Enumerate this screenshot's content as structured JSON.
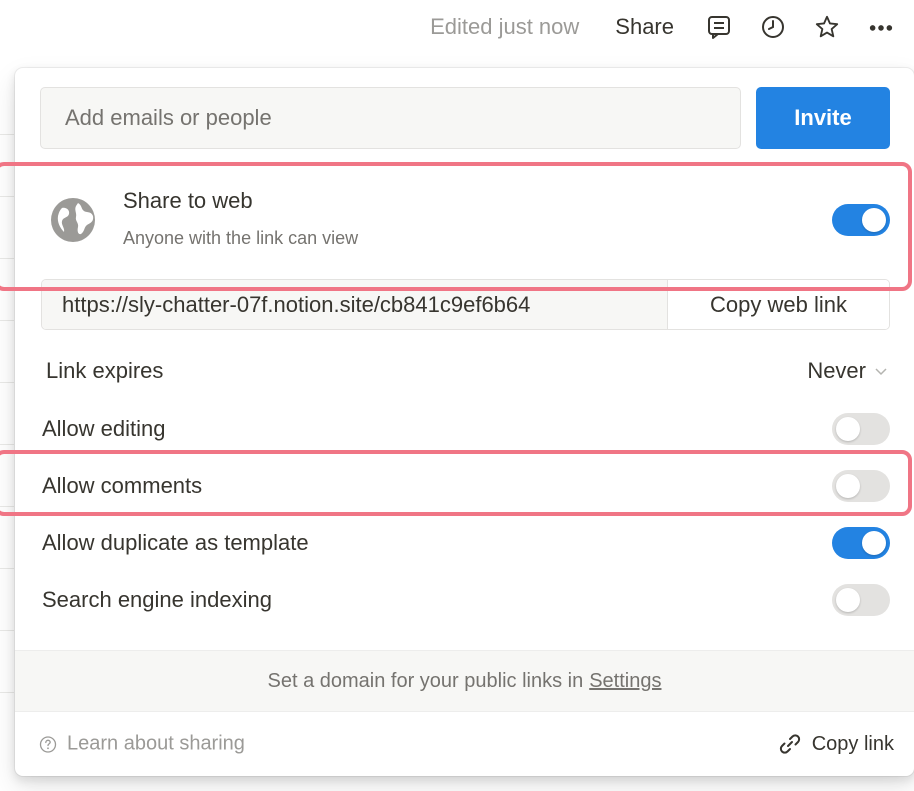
{
  "topbar": {
    "edited_label": "Edited just now",
    "share_label": "Share",
    "icons": [
      "comment-icon",
      "clock-icon",
      "star-icon",
      "more-icon"
    ]
  },
  "invite": {
    "placeholder": "Add emails or people",
    "button_label": "Invite"
  },
  "share_to_web": {
    "title": "Share to web",
    "subtitle": "Anyone with the link can view",
    "enabled": true,
    "icon": "globe-icon"
  },
  "web_link": {
    "url": "https://sly-chatter-07f.notion.site/cb841c9ef6b64",
    "copy_label": "Copy web link"
  },
  "options": {
    "link_expires": {
      "label": "Link expires",
      "value": "Never"
    },
    "allow_editing": {
      "label": "Allow editing",
      "enabled": false
    },
    "allow_comments": {
      "label": "Allow comments",
      "enabled": false
    },
    "allow_duplicate": {
      "label": "Allow duplicate as template",
      "enabled": true
    },
    "search_indexing": {
      "label": "Search engine indexing",
      "enabled": false
    }
  },
  "domain_notice": {
    "text": "Set a domain for your public links in",
    "link_label": "Settings"
  },
  "footer": {
    "learn_label": "Learn about sharing",
    "copy_link_label": "Copy link"
  },
  "colors": {
    "accent": "#2383e2",
    "highlight": "#f07585",
    "toggle_off": "#e3e2e0"
  }
}
